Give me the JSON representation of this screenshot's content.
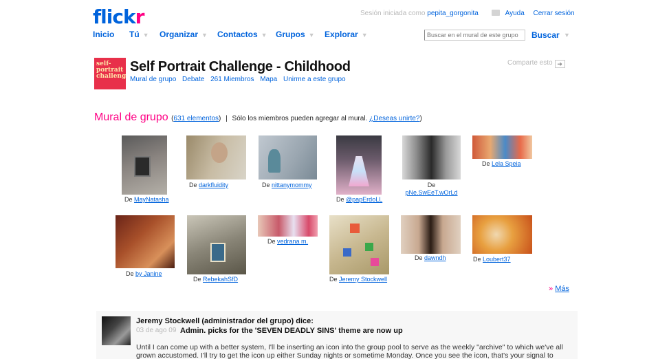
{
  "brand": {
    "logo_main": "flick",
    "logo_r": "r"
  },
  "account": {
    "signed_in_as": "Sesión iniciada como",
    "username": "pepita_gorgonita",
    "help": "Ayuda",
    "logout": "Cerrar sesión"
  },
  "nav": {
    "items": [
      {
        "label": "Inicio"
      },
      {
        "label": "Tú"
      },
      {
        "label": "Organizar"
      },
      {
        "label": "Contactos"
      },
      {
        "label": "Grupos"
      },
      {
        "label": "Explorar"
      }
    ]
  },
  "search": {
    "placeholder": "Buscar en el mural de este grupo",
    "button": "Buscar"
  },
  "group": {
    "icon_text": "self-portrait challenge",
    "title": "Self Portrait Challenge - Childhood",
    "links": [
      "Mural de grupo",
      "Debate",
      "261 Miembros",
      "Mapa",
      "Unirme a este grupo"
    ],
    "share": "Comparte esto"
  },
  "mural": {
    "heading": "Mural de grupo",
    "count": "631 elementos",
    "sep": "|",
    "notice": "Sólo los miembros pueden agregar al mural.",
    "join": "¿Deseas unirte?",
    "paren_open": "(",
    "paren_close": ")",
    "by": "De",
    "photos": [
      {
        "author": "MayNatasha",
        "colors": [
          "#5a5a5a",
          "#b4b0a8"
        ]
      },
      {
        "author": "darkfluidity",
        "colors": [
          "#9a8a6a",
          "#d8d4c8"
        ]
      },
      {
        "author": "nittanymommy",
        "colors": [
          "#7a8a96",
          "#c0c8d0"
        ]
      },
      {
        "author": "@papErdoLL",
        "colors": [
          "#3a3a42",
          "#e0b0c8"
        ]
      },
      {
        "author": "pNe.SwEeT.wOrLd",
        "colors": [
          "#2a2a2a",
          "#d8d8d8"
        ]
      },
      {
        "author": "Lela Speia",
        "colors": [
          "#d05a3a",
          "#e8a870"
        ]
      },
      {
        "author": "by Janine",
        "colors": [
          "#6a2418",
          "#d8905a"
        ]
      },
      {
        "author": "RebekahSfD",
        "colors": [
          "#5a5648",
          "#cac6b8"
        ]
      },
      {
        "author": "vedrana m.",
        "colors": [
          "#c85a6a",
          "#e8c8b8"
        ]
      },
      {
        "author": "Jeremy Stockwell",
        "colors": [
          "#c8b890",
          "#e85a3a"
        ]
      },
      {
        "author": "dawndh",
        "colors": [
          "#2a1c14",
          "#e0d0c0"
        ]
      },
      {
        "author": "Loubert37",
        "colors": [
          "#e8a040",
          "#f0d8b0"
        ]
      }
    ],
    "more_arrows": "»",
    "more": "Más"
  },
  "post": {
    "author": "Jeremy Stockwell (administrador del grupo) dice:",
    "date": "03 de ago 09",
    "title": "Admin. picks for the 'SEVEN DEADLY SINS' theme are now up",
    "body": "Until I can come up with a better system, I'll be inserting an icon into the group pool to serve as the weekly \"archive\" to which we've all grown accustomed. I'll try to get the icon up either Sunday nights or sometime Monday. Once you see the icon, that's your signal to"
  }
}
